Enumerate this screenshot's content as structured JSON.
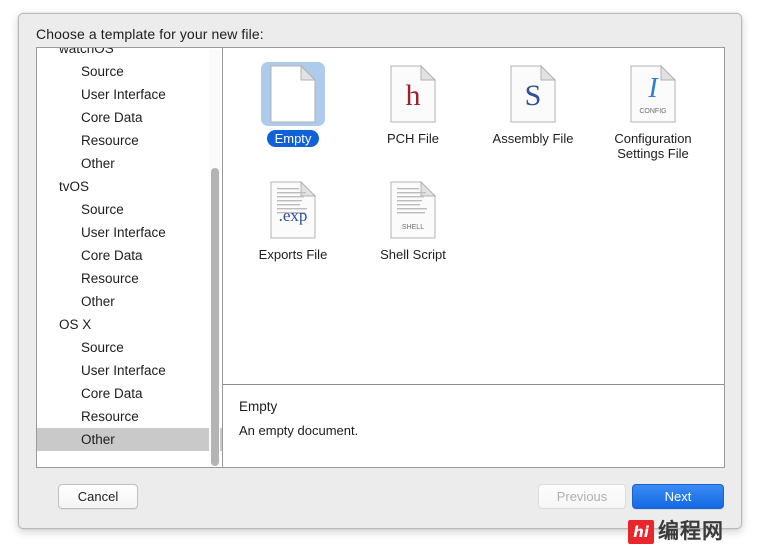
{
  "dialog": {
    "title": "Choose a template for your new file:"
  },
  "sidebar": {
    "items": [
      {
        "label": "watchOS",
        "type": "group",
        "selected": false
      },
      {
        "label": "Source",
        "type": "child",
        "selected": false
      },
      {
        "label": "User Interface",
        "type": "child",
        "selected": false
      },
      {
        "label": "Core Data",
        "type": "child",
        "selected": false
      },
      {
        "label": "Resource",
        "type": "child",
        "selected": false
      },
      {
        "label": "Other",
        "type": "child",
        "selected": false
      },
      {
        "label": "tvOS",
        "type": "group",
        "selected": false
      },
      {
        "label": "Source",
        "type": "child",
        "selected": false
      },
      {
        "label": "User Interface",
        "type": "child",
        "selected": false
      },
      {
        "label": "Core Data",
        "type": "child",
        "selected": false
      },
      {
        "label": "Resource",
        "type": "child",
        "selected": false
      },
      {
        "label": "Other",
        "type": "child",
        "selected": false
      },
      {
        "label": "OS X",
        "type": "group",
        "selected": false
      },
      {
        "label": "Source",
        "type": "child",
        "selected": false
      },
      {
        "label": "User Interface",
        "type": "child",
        "selected": false
      },
      {
        "label": "Core Data",
        "type": "child",
        "selected": false
      },
      {
        "label": "Resource",
        "type": "child",
        "selected": false
      },
      {
        "label": "Other",
        "type": "child",
        "selected": true
      }
    ],
    "scrollbar": {
      "name": "sidebar-scrollbar"
    }
  },
  "templates": [
    {
      "label": "Empty",
      "icon": "empty-document-icon",
      "selected": true,
      "glyph": "",
      "glyph_color": "#1d1d1d",
      "sub": ""
    },
    {
      "label": "PCH File",
      "icon": "pch-file-icon",
      "selected": false,
      "glyph": "h",
      "glyph_color": "#9e1f30",
      "sub": ""
    },
    {
      "label": "Assembly File",
      "icon": "assembly-file-icon",
      "selected": false,
      "glyph": "S",
      "glyph_color": "#2d4f9e",
      "sub": ""
    },
    {
      "label": "Configuration Settings File",
      "icon": "configuration-settings-file-icon",
      "selected": false,
      "glyph": "I",
      "glyph_color": "#2f7fd0",
      "sub": "CONFIG"
    },
    {
      "label": "Exports File",
      "icon": "exports-file-icon",
      "selected": false,
      "glyph": ".exp",
      "glyph_color": "#2d4f9e",
      "sub": ""
    },
    {
      "label": "Shell Script",
      "icon": "shell-script-icon",
      "selected": false,
      "glyph": "",
      "glyph_color": "#4a4a4a",
      "sub": "SHELL"
    }
  ],
  "description": {
    "title": "Empty",
    "body": "An empty document."
  },
  "footer": {
    "cancel_label": "Cancel",
    "previous_label": "Previous",
    "previous_disabled": true,
    "next_label": "Next"
  },
  "watermark": {
    "badge": "hi",
    "text": "编程网"
  },
  "colors": {
    "accent": "#1468e4",
    "selection_blue": "#1060d8",
    "selection_tile_bg": "#aecbeb",
    "sidebar_selection": "#c9c9c9",
    "dialog_bg": "#ececec"
  }
}
